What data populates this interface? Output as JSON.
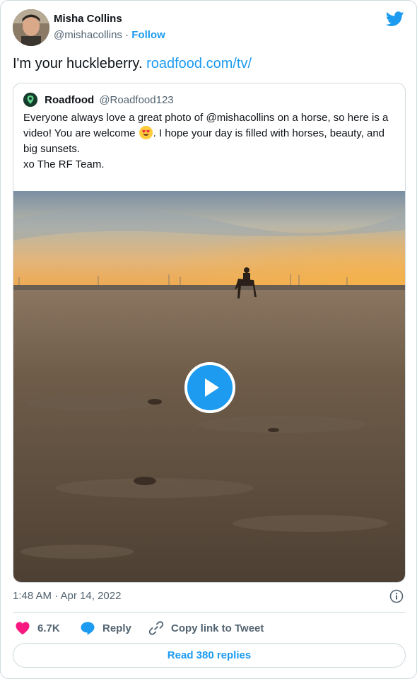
{
  "author": {
    "name": "Misha Collins",
    "handle": "@mishacollins",
    "separator": "·",
    "follow_label": "Follow"
  },
  "tweet": {
    "text": "I'm your huckleberry.",
    "link_text": "roadfood.com/tv/"
  },
  "quoted_tweet": {
    "name": "Roadfood",
    "handle": "@Roadfood123",
    "text_part1": "Everyone always love a great photo of @mishacollins  on a horse, so here is a video! You are welcome",
    "text_part2": ". I hope your day is filled with horses, beauty, and big sunsets.",
    "text_line_last": "xo The RF Team.",
    "emoji": "heart-eyes-emoji"
  },
  "meta": {
    "timestamp": "1:48 AM · Apr 14, 2022"
  },
  "actions": {
    "like_count": "6.7K",
    "reply_label": "Reply",
    "copy_link_label": "Copy link to Tweet",
    "read_replies_label": "Read 380 replies"
  },
  "colors": {
    "accent": "#1d9bf0",
    "like": "#f91880",
    "text_secondary": "#536471",
    "border": "#cfd9de"
  },
  "icons": [
    "twitter-bird-icon",
    "info-icon",
    "heart-icon",
    "reply-bubble-icon",
    "link-icon",
    "play-icon"
  ]
}
